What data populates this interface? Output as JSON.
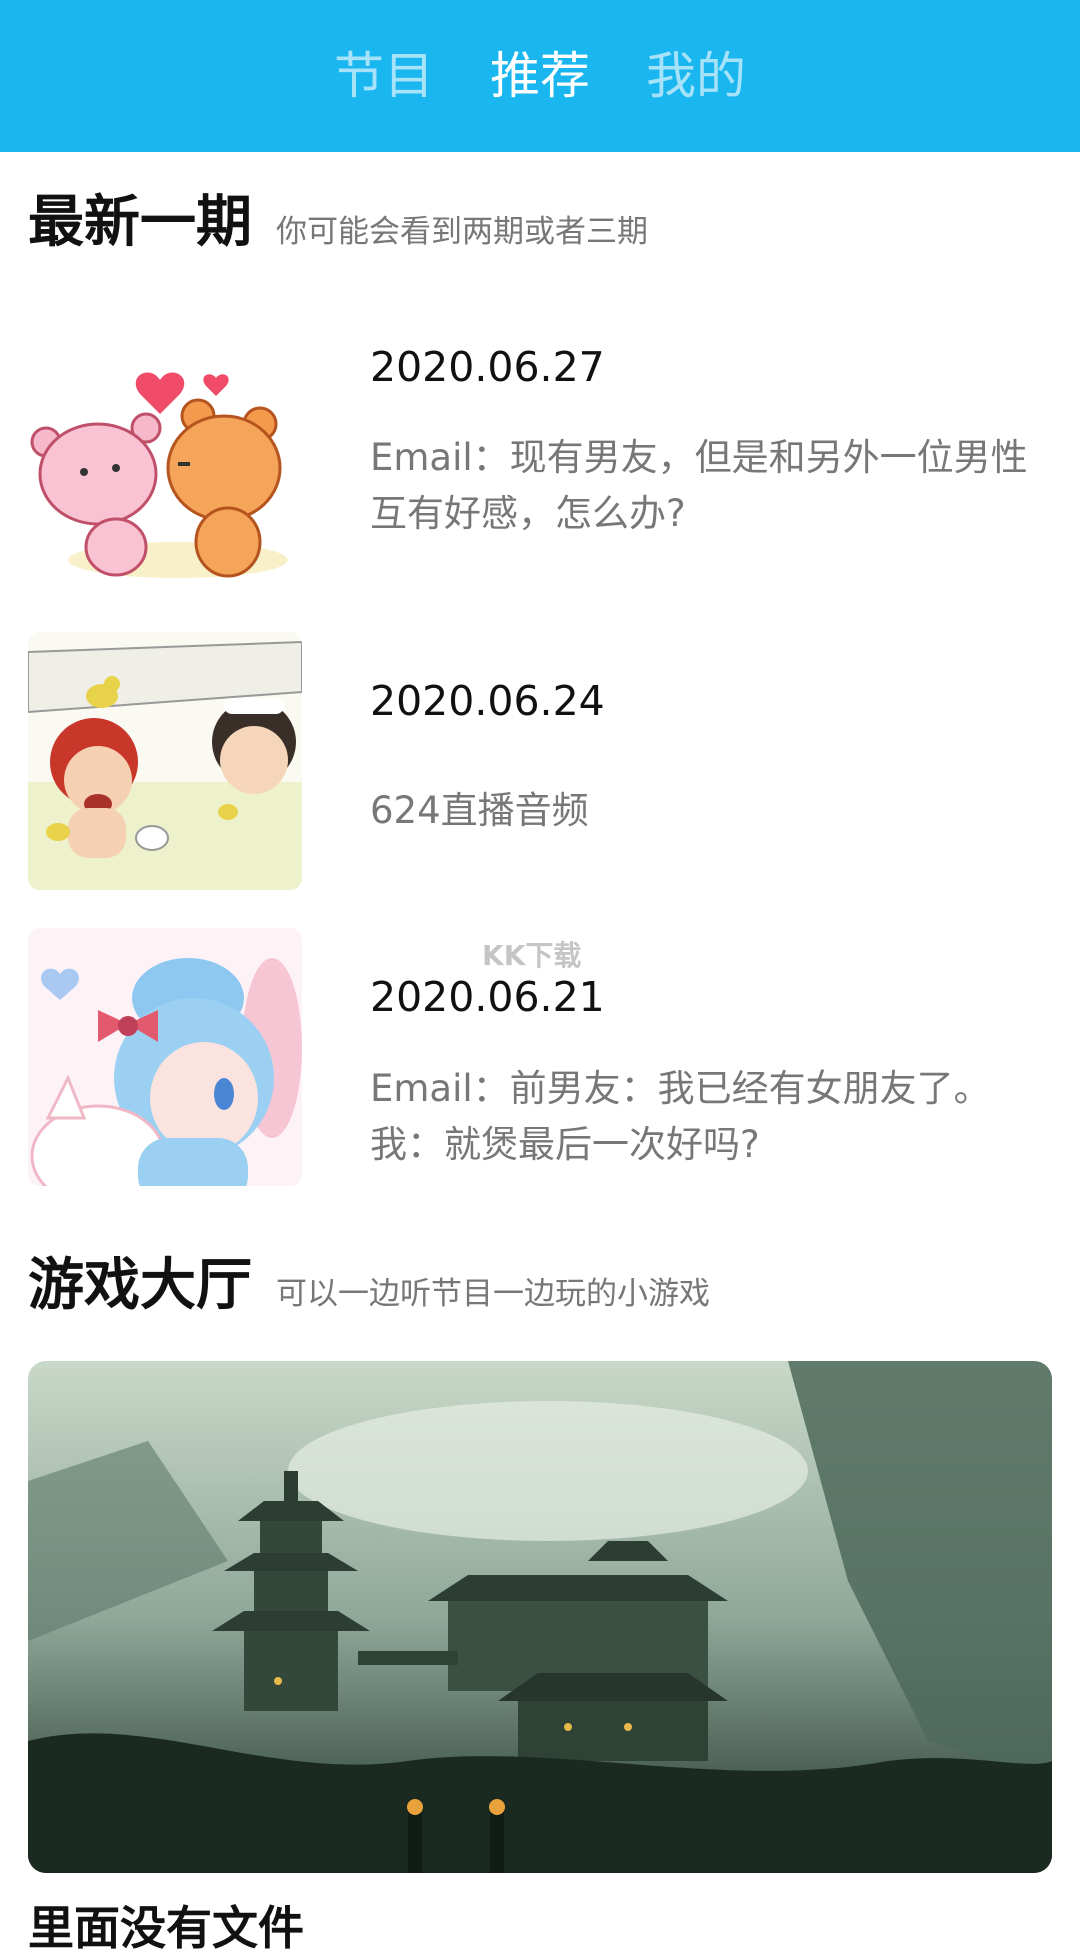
{
  "header": {
    "tabs": [
      {
        "label": "节目",
        "active": false
      },
      {
        "label": "推荐",
        "active": true
      },
      {
        "label": "我的",
        "active": false
      }
    ],
    "background_color": "#1ab6f0"
  },
  "latest": {
    "title": "最新一期",
    "subtitle": "你可能会看到两期或者三期",
    "episodes": [
      {
        "date": "2020.06.27",
        "desc": "Email：现有男友，但是和另外一位男性互有好感，怎么办?",
        "thumb_icon": "bears-couple-image"
      },
      {
        "date": "2020.06.24",
        "desc": "624直播音频",
        "thumb_icon": "bath-boys-image"
      },
      {
        "date": "2020.06.21",
        "desc": "Email：前男友：我已经有女朋友了。我：就煲最后一次好吗?",
        "thumb_icon": "blue-hair-girl-image"
      }
    ]
  },
  "games": {
    "title": "游戏大厅",
    "subtitle": "可以一边听节目一边玩的小游戏",
    "banner_icon": "misty-temple-landscape-image"
  },
  "bottom_partial_title": "里面没有文件",
  "watermark": "KK下载"
}
